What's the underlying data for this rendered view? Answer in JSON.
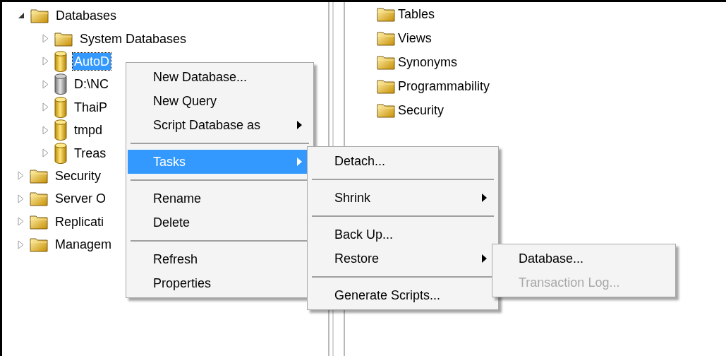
{
  "object_explorer": [
    {
      "label": "Databases",
      "kind": "folder",
      "expanded": true,
      "selected": false,
      "children": [
        {
          "label": "System Databases",
          "kind": "folder",
          "expanded": false,
          "selected": false
        },
        {
          "label": "AutoD",
          "kind": "database",
          "expanded": false,
          "selected": true
        },
        {
          "label": "D:\\NC",
          "kind": "offline-database",
          "expanded": false,
          "selected": false
        },
        {
          "label": "ThaiP",
          "kind": "database",
          "expanded": false,
          "selected": false
        },
        {
          "label": "tmpd",
          "kind": "database",
          "expanded": false,
          "selected": false
        },
        {
          "label": "Treas",
          "kind": "database",
          "expanded": false,
          "selected": false
        }
      ]
    },
    {
      "label": "Security",
      "kind": "folder",
      "expanded": false,
      "selected": false
    },
    {
      "label": "Server O",
      "kind": "folder",
      "expanded": false,
      "selected": false
    },
    {
      "label": "Replicati",
      "kind": "folder",
      "expanded": false,
      "selected": false
    },
    {
      "label": "Managem",
      "kind": "folder",
      "expanded": false,
      "selected": false
    }
  ],
  "details_list": [
    {
      "label": "Tables"
    },
    {
      "label": "Views"
    },
    {
      "label": "Synonyms"
    },
    {
      "label": "Programmability"
    },
    {
      "label": "Security"
    }
  ],
  "context_menu": {
    "items": [
      {
        "kind": "item",
        "label": "New Database...",
        "submenu": false,
        "selected": false,
        "disabled": false
      },
      {
        "kind": "item",
        "label": "New Query",
        "submenu": false,
        "selected": false,
        "disabled": false
      },
      {
        "kind": "item",
        "label": "Script Database as",
        "submenu": true,
        "selected": false,
        "disabled": false
      },
      {
        "kind": "separator"
      },
      {
        "kind": "item",
        "label": "Tasks",
        "submenu": true,
        "selected": true,
        "disabled": false
      },
      {
        "kind": "separator"
      },
      {
        "kind": "item",
        "label": "Rename",
        "submenu": false,
        "selected": false,
        "disabled": false
      },
      {
        "kind": "item",
        "label": "Delete",
        "submenu": false,
        "selected": false,
        "disabled": false
      },
      {
        "kind": "separator"
      },
      {
        "kind": "item",
        "label": "Refresh",
        "submenu": false,
        "selected": false,
        "disabled": false
      },
      {
        "kind": "item",
        "label": "Properties",
        "submenu": false,
        "selected": false,
        "disabled": false
      }
    ]
  },
  "tasks_submenu": {
    "items": [
      {
        "kind": "item",
        "label": "Detach...",
        "submenu": false,
        "selected": false,
        "disabled": false
      },
      {
        "kind": "separator"
      },
      {
        "kind": "item",
        "label": "Shrink",
        "submenu": true,
        "selected": false,
        "disabled": false
      },
      {
        "kind": "separator"
      },
      {
        "kind": "item",
        "label": "Back Up...",
        "submenu": false,
        "selected": false,
        "disabled": false
      },
      {
        "kind": "item",
        "label": "Restore",
        "submenu": true,
        "selected": false,
        "disabled": false
      },
      {
        "kind": "separator"
      },
      {
        "kind": "item",
        "label": "Generate Scripts...",
        "submenu": false,
        "selected": false,
        "disabled": false
      }
    ]
  },
  "restore_submenu": {
    "items": [
      {
        "kind": "item",
        "label": "Database...",
        "submenu": false,
        "selected": false,
        "disabled": false
      },
      {
        "kind": "item",
        "label": "Transaction Log...",
        "submenu": false,
        "selected": false,
        "disabled": true
      }
    ]
  }
}
